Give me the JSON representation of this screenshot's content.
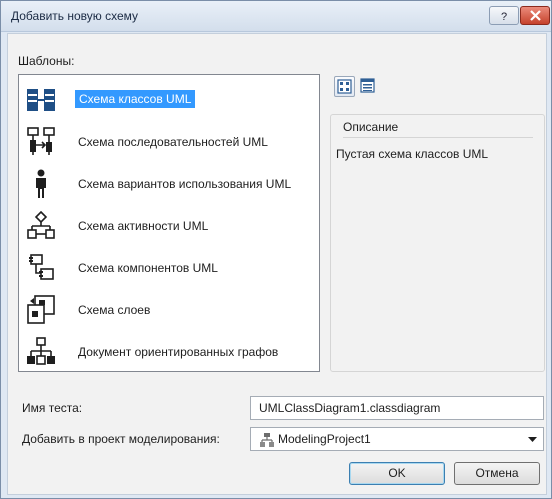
{
  "window": {
    "title": "Добавить новую схему",
    "help_label": "?",
    "close_label": "X"
  },
  "templates": {
    "label": "Шаблоны:",
    "items": [
      {
        "label": "Схема классов UML",
        "icon": "class-diagram-icon",
        "selected": true
      },
      {
        "label": "Схема последовательностей UML",
        "icon": "sequence-diagram-icon"
      },
      {
        "label": "Схема вариантов использования UML",
        "icon": "use-case-diagram-icon"
      },
      {
        "label": "Схема активности UML",
        "icon": "activity-diagram-icon"
      },
      {
        "label": "Схема компонентов UML",
        "icon": "component-diagram-icon"
      },
      {
        "label": "Схема слоев",
        "icon": "layer-diagram-icon"
      },
      {
        "label": "Документ ориентированных графов",
        "icon": "directed-graph-icon"
      }
    ]
  },
  "view_toggle": {
    "large_icons": "large-icons-view-icon",
    "list": "list-view-icon"
  },
  "description": {
    "header": "Описание",
    "text": "Пустая схема классов UML"
  },
  "name_field": {
    "label": "Имя теста:",
    "value": "UMLClassDiagram1.classdiagram"
  },
  "project_field": {
    "label": "Добавить в проект моделирования:",
    "value": "ModelingProject1"
  },
  "buttons": {
    "ok": "OK",
    "cancel": "Отмена"
  },
  "colors": {
    "selection": "#3399ff",
    "icon_blue": "#1f4f86",
    "close_red": "#c5422c"
  }
}
